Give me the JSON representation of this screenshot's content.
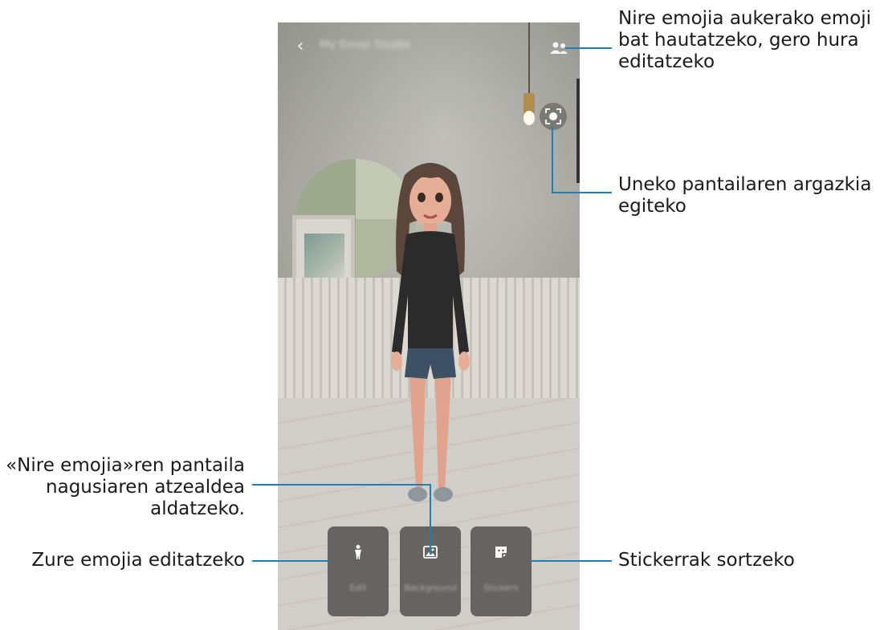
{
  "app": {
    "title": "My Emoji Studio",
    "back_icon": "chevron-left-icon"
  },
  "toolbar": {
    "select_emoji_icon": "people-icon",
    "capture_icon": "face-capture-icon"
  },
  "bottom_buttons": [
    {
      "label": "Edit",
      "icon": "person-icon"
    },
    {
      "label": "Background",
      "icon": "image-icon"
    },
    {
      "label": "Stickers",
      "icon": "sticker-icon"
    }
  ],
  "callouts": {
    "select_emoji": [
      "Nire emojia aukerako emoji",
      "bat hautatzeko, gero hura",
      "editatzeko"
    ],
    "capture": [
      "Uneko pantailaren argazkia",
      "egiteko"
    ],
    "background": [
      "«Nire emojia»ren pantaila",
      "nagusiaren atzealdea",
      "aldatzeko."
    ],
    "edit": [
      "Zure emojia editatzeko"
    ],
    "stickers": [
      "Stickerrak sortzeko"
    ]
  },
  "colors": {
    "callout_line": "#1c7fb6",
    "button_bg": "#464646"
  }
}
